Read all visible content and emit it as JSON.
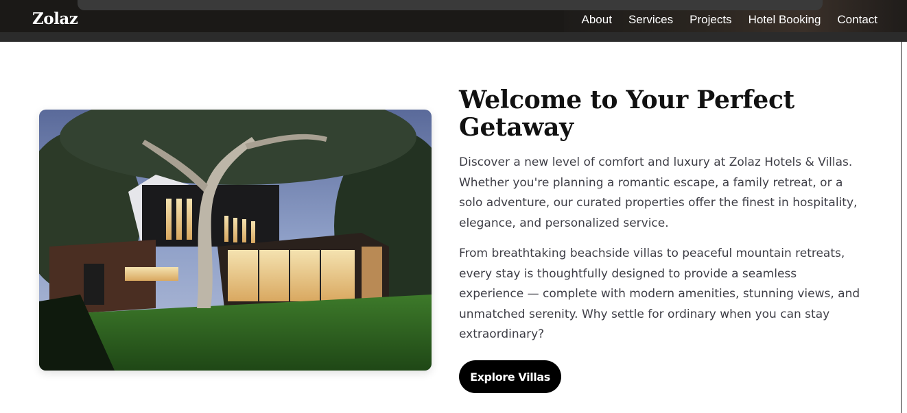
{
  "header": {
    "logo": "Zolaz",
    "nav": [
      "About",
      "Services",
      "Projects",
      "Hotel Booking",
      "Contact"
    ]
  },
  "hero": {
    "image_icon": "villa-photo",
    "title": "Welcome to Your Perfect Getaway",
    "paragraphs": [
      "Discover a new level of comfort and luxury at Zolaz Hotels & Villas. Whether you're planning a romantic escape, a family retreat, or a solo adventure, our curated properties offer the finest in hospitality, elegance, and personalized service.",
      "From breathtaking beachside villas to peaceful mountain retreats, every stay is thoughtfully designed to provide a seamless experience — complete with modern amenities, stunning views, and unmatched serenity. Why settle for ordinary when you can stay extraordinary?"
    ],
    "button_label": "Explore Villas"
  },
  "colors": {
    "header_bg": "#1b1917",
    "button_bg": "#000000",
    "text": "#3e3e46"
  }
}
